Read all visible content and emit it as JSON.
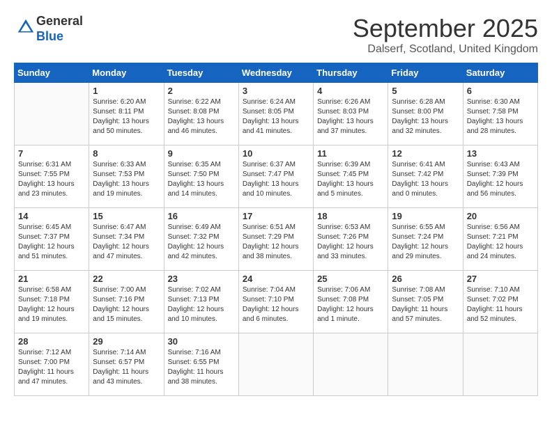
{
  "header": {
    "logo_line1": "General",
    "logo_line2": "Blue",
    "month": "September 2025",
    "location": "Dalserf, Scotland, United Kingdom"
  },
  "days_of_week": [
    "Sunday",
    "Monday",
    "Tuesday",
    "Wednesday",
    "Thursday",
    "Friday",
    "Saturday"
  ],
  "weeks": [
    [
      {
        "day": "",
        "info": ""
      },
      {
        "day": "1",
        "info": "Sunrise: 6:20 AM\nSunset: 8:11 PM\nDaylight: 13 hours\nand 50 minutes."
      },
      {
        "day": "2",
        "info": "Sunrise: 6:22 AM\nSunset: 8:08 PM\nDaylight: 13 hours\nand 46 minutes."
      },
      {
        "day": "3",
        "info": "Sunrise: 6:24 AM\nSunset: 8:05 PM\nDaylight: 13 hours\nand 41 minutes."
      },
      {
        "day": "4",
        "info": "Sunrise: 6:26 AM\nSunset: 8:03 PM\nDaylight: 13 hours\nand 37 minutes."
      },
      {
        "day": "5",
        "info": "Sunrise: 6:28 AM\nSunset: 8:00 PM\nDaylight: 13 hours\nand 32 minutes."
      },
      {
        "day": "6",
        "info": "Sunrise: 6:30 AM\nSunset: 7:58 PM\nDaylight: 13 hours\nand 28 minutes."
      }
    ],
    [
      {
        "day": "7",
        "info": "Sunrise: 6:31 AM\nSunset: 7:55 PM\nDaylight: 13 hours\nand 23 minutes."
      },
      {
        "day": "8",
        "info": "Sunrise: 6:33 AM\nSunset: 7:53 PM\nDaylight: 13 hours\nand 19 minutes."
      },
      {
        "day": "9",
        "info": "Sunrise: 6:35 AM\nSunset: 7:50 PM\nDaylight: 13 hours\nand 14 minutes."
      },
      {
        "day": "10",
        "info": "Sunrise: 6:37 AM\nSunset: 7:47 PM\nDaylight: 13 hours\nand 10 minutes."
      },
      {
        "day": "11",
        "info": "Sunrise: 6:39 AM\nSunset: 7:45 PM\nDaylight: 13 hours\nand 5 minutes."
      },
      {
        "day": "12",
        "info": "Sunrise: 6:41 AM\nSunset: 7:42 PM\nDaylight: 13 hours\nand 0 minutes."
      },
      {
        "day": "13",
        "info": "Sunrise: 6:43 AM\nSunset: 7:39 PM\nDaylight: 12 hours\nand 56 minutes."
      }
    ],
    [
      {
        "day": "14",
        "info": "Sunrise: 6:45 AM\nSunset: 7:37 PM\nDaylight: 12 hours\nand 51 minutes."
      },
      {
        "day": "15",
        "info": "Sunrise: 6:47 AM\nSunset: 7:34 PM\nDaylight: 12 hours\nand 47 minutes."
      },
      {
        "day": "16",
        "info": "Sunrise: 6:49 AM\nSunset: 7:32 PM\nDaylight: 12 hours\nand 42 minutes."
      },
      {
        "day": "17",
        "info": "Sunrise: 6:51 AM\nSunset: 7:29 PM\nDaylight: 12 hours\nand 38 minutes."
      },
      {
        "day": "18",
        "info": "Sunrise: 6:53 AM\nSunset: 7:26 PM\nDaylight: 12 hours\nand 33 minutes."
      },
      {
        "day": "19",
        "info": "Sunrise: 6:55 AM\nSunset: 7:24 PM\nDaylight: 12 hours\nand 29 minutes."
      },
      {
        "day": "20",
        "info": "Sunrise: 6:56 AM\nSunset: 7:21 PM\nDaylight: 12 hours\nand 24 minutes."
      }
    ],
    [
      {
        "day": "21",
        "info": "Sunrise: 6:58 AM\nSunset: 7:18 PM\nDaylight: 12 hours\nand 19 minutes."
      },
      {
        "day": "22",
        "info": "Sunrise: 7:00 AM\nSunset: 7:16 PM\nDaylight: 12 hours\nand 15 minutes."
      },
      {
        "day": "23",
        "info": "Sunrise: 7:02 AM\nSunset: 7:13 PM\nDaylight: 12 hours\nand 10 minutes."
      },
      {
        "day": "24",
        "info": "Sunrise: 7:04 AM\nSunset: 7:10 PM\nDaylight: 12 hours\nand 6 minutes."
      },
      {
        "day": "25",
        "info": "Sunrise: 7:06 AM\nSunset: 7:08 PM\nDaylight: 12 hours\nand 1 minute."
      },
      {
        "day": "26",
        "info": "Sunrise: 7:08 AM\nSunset: 7:05 PM\nDaylight: 11 hours\nand 57 minutes."
      },
      {
        "day": "27",
        "info": "Sunrise: 7:10 AM\nSunset: 7:02 PM\nDaylight: 11 hours\nand 52 minutes."
      }
    ],
    [
      {
        "day": "28",
        "info": "Sunrise: 7:12 AM\nSunset: 7:00 PM\nDaylight: 11 hours\nand 47 minutes."
      },
      {
        "day": "29",
        "info": "Sunrise: 7:14 AM\nSunset: 6:57 PM\nDaylight: 11 hours\nand 43 minutes."
      },
      {
        "day": "30",
        "info": "Sunrise: 7:16 AM\nSunset: 6:55 PM\nDaylight: 11 hours\nand 38 minutes."
      },
      {
        "day": "",
        "info": ""
      },
      {
        "day": "",
        "info": ""
      },
      {
        "day": "",
        "info": ""
      },
      {
        "day": "",
        "info": ""
      }
    ]
  ]
}
